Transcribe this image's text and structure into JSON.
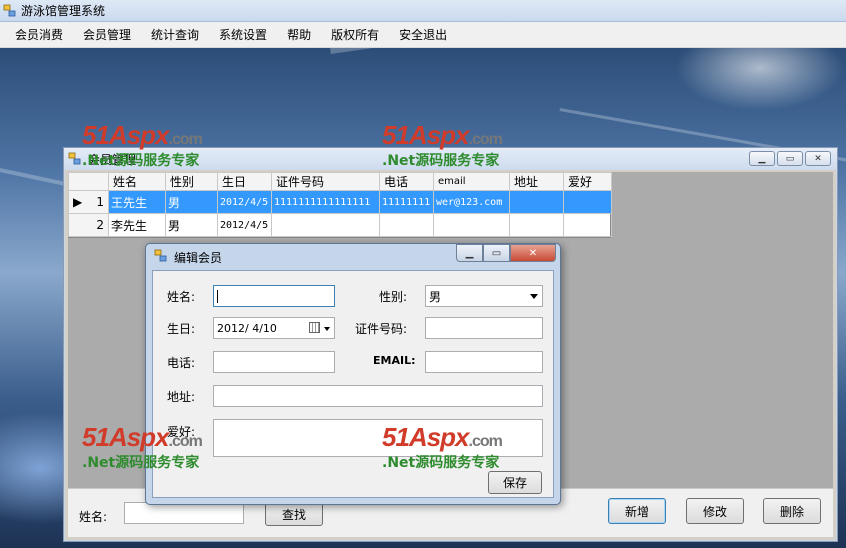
{
  "app": {
    "title": "游泳馆管理系统"
  },
  "menu": [
    "会员消费",
    "会员管理",
    "统计查询",
    "系统设置",
    "帮助",
    "版权所有",
    "安全退出"
  ],
  "watermark": {
    "logo": "51Aspx",
    "com": ".com",
    "sub": ".Net源码服务专家"
  },
  "member_window": {
    "title": "会员管理",
    "columns": [
      "姓名",
      "性别",
      "生日",
      "证件号码",
      "电话",
      "email",
      "地址",
      "爱好"
    ],
    "rows": [
      {
        "index": "1",
        "name": "王先生",
        "gender": "男",
        "birthday": "2012/4/5",
        "id_no": "1111111111111111",
        "phone": "11111111",
        "email": "wer@123.com",
        "address": "",
        "hobby": ""
      },
      {
        "index": "2",
        "name": "李先生",
        "gender": "男",
        "birthday": "2012/4/5",
        "id_no": "",
        "phone": "",
        "email": "",
        "address": "",
        "hobby": ""
      }
    ],
    "search_label": "姓名:",
    "search_value": "",
    "search_button": "查找",
    "add_button": "新增",
    "edit_button": "修改",
    "delete_button": "删除"
  },
  "edit_dialog": {
    "title": "编辑会员",
    "name_label": "姓名:",
    "name_value": "",
    "gender_label": "性别:",
    "gender_value": "男",
    "birthday_label": "生日:",
    "birthday_value": "2012/ 4/10",
    "id_label": "证件号码:",
    "id_value": "",
    "phone_label": "电话:",
    "phone_value": "",
    "email_label": "EMAIL:",
    "email_value": "",
    "address_label": "地址:",
    "address_value": "",
    "hobby_label": "爱好:",
    "hobby_value": "",
    "save_button": "保存"
  },
  "colors": {
    "selection": "#3399ff",
    "watermark_red": "#d13b2a",
    "watermark_green": "#2e8b2e"
  }
}
